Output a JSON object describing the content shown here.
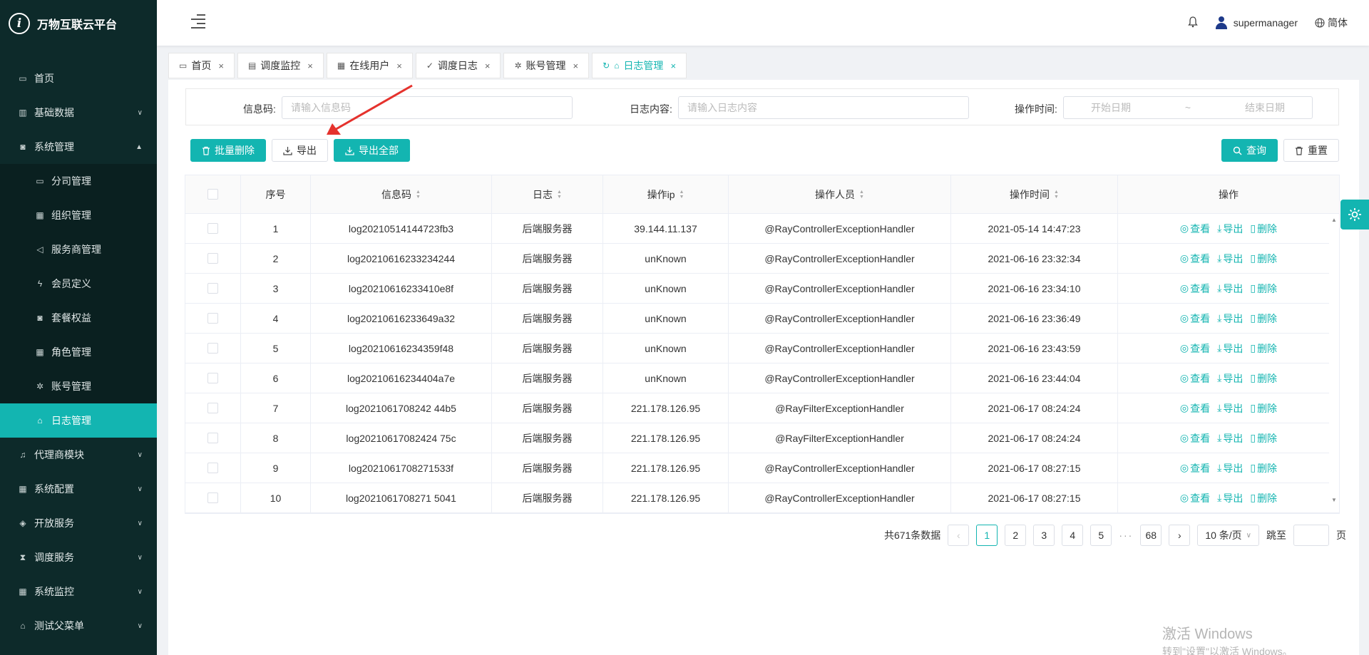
{
  "app": {
    "title": "万物互联云平台",
    "logo_letter": "i"
  },
  "header": {
    "username": "supermanager",
    "language": "简体"
  },
  "sidebar": {
    "items": [
      {
        "label": "首页",
        "icon": "calendar-icon"
      },
      {
        "label": "基础数据",
        "icon": "barcode-icon",
        "expandable": true
      },
      {
        "label": "系统管理",
        "icon": "camera-icon",
        "expandable": true,
        "expanded": true
      },
      {
        "label": "分司管理",
        "icon": "calendar-icon",
        "sub": true
      },
      {
        "label": "组织管理",
        "icon": "grid-icon",
        "sub": true
      },
      {
        "label": "服务商管理",
        "icon": "speaker-icon",
        "sub": true
      },
      {
        "label": "会员定义",
        "icon": "lightning-icon",
        "sub": true
      },
      {
        "label": "套餐权益",
        "icon": "camera-icon",
        "sub": true
      },
      {
        "label": "角色管理",
        "icon": "grid-icon",
        "sub": true
      },
      {
        "label": "账号管理",
        "icon": "bug-icon",
        "sub": true
      },
      {
        "label": "日志管理",
        "icon": "home-icon",
        "sub": true,
        "active": true
      },
      {
        "label": "代理商模块",
        "icon": "bell-icon",
        "expandable": true
      },
      {
        "label": "系统配置",
        "icon": "grid-icon",
        "expandable": true
      },
      {
        "label": "开放服务",
        "icon": "tag-icon",
        "expandable": true
      },
      {
        "label": "调度服务",
        "icon": "hourglass-icon",
        "expandable": true
      },
      {
        "label": "系统监控",
        "icon": "grid-icon",
        "expandable": true
      },
      {
        "label": "测试父菜单",
        "icon": "bank-icon",
        "expandable": true
      }
    ]
  },
  "tabs": [
    {
      "label": "首页",
      "icon": "calendar-icon"
    },
    {
      "label": "调度监控",
      "icon": "chart-icon"
    },
    {
      "label": "在线用户",
      "icon": "grid-icon"
    },
    {
      "label": "调度日志",
      "icon": "check-icon"
    },
    {
      "label": "账号管理",
      "icon": "bug-icon"
    },
    {
      "label": "日志管理",
      "icon": "home-icon",
      "active": true
    }
  ],
  "search": {
    "code_label": "信息码:",
    "code_placeholder": "请输入信息码",
    "content_label": "日志内容:",
    "content_placeholder": "请输入日志内容",
    "time_label": "操作时间:",
    "start_placeholder": "开始日期",
    "range_sep": "~",
    "end_placeholder": "结束日期"
  },
  "toolbar": {
    "batch_delete": "批量删除",
    "export": "导出",
    "export_all": "导出全部",
    "query": "查询",
    "reset": "重置"
  },
  "table": {
    "headers": [
      "序号",
      "信息码",
      "日志",
      "操作ip",
      "操作人员",
      "操作时间",
      "操作"
    ],
    "op_labels": {
      "view": "查看",
      "export": "导出",
      "delete": "删除"
    },
    "rows": [
      {
        "no": "1",
        "code": "log20210514144723fb3",
        "log": "后端服务器",
        "ip": "39.144.11.137",
        "operator": "@RayControllerExceptionHandler",
        "time": "2021-05-14 14:47:23"
      },
      {
        "no": "2",
        "code": "log20210616233234244",
        "log": "后端服务器",
        "ip": "unKnown",
        "operator": "@RayControllerExceptionHandler",
        "time": "2021-06-16 23:32:34"
      },
      {
        "no": "3",
        "code": "log20210616233410e8f",
        "log": "后端服务器",
        "ip": "unKnown",
        "operator": "@RayControllerExceptionHandler",
        "time": "2021-06-16 23:34:10"
      },
      {
        "no": "4",
        "code": "log20210616233649a32",
        "log": "后端服务器",
        "ip": "unKnown",
        "operator": "@RayControllerExceptionHandler",
        "time": "2021-06-16 23:36:49"
      },
      {
        "no": "5",
        "code": "log20210616234359f48",
        "log": "后端服务器",
        "ip": "unKnown",
        "operator": "@RayControllerExceptionHandler",
        "time": "2021-06-16 23:43:59"
      },
      {
        "no": "6",
        "code": "log20210616234404a7e",
        "log": "后端服务器",
        "ip": "unKnown",
        "operator": "@RayControllerExceptionHandler",
        "time": "2021-06-16 23:44:04"
      },
      {
        "no": "7",
        "code": "log2021061708242 44b5",
        "log": "后端服务器",
        "ip": "221.178.126.95",
        "operator": "@RayFilterExceptionHandler",
        "time": "2021-06-17 08:24:24"
      },
      {
        "no": "8",
        "code": "log20210617082424 75c",
        "log": "后端服务器",
        "ip": "221.178.126.95",
        "operator": "@RayFilterExceptionHandler",
        "time": "2021-06-17 08:24:24"
      },
      {
        "no": "9",
        "code": "log2021061708271533f",
        "log": "后端服务器",
        "ip": "221.178.126.95",
        "operator": "@RayControllerExceptionHandler",
        "time": "2021-06-17 08:27:15"
      },
      {
        "no": "10",
        "code": "log2021061708271 5041",
        "log": "后端服务器",
        "ip": "221.178.126.95",
        "operator": "@RayControllerExceptionHandler",
        "time": "2021-06-17 08:27:15"
      }
    ]
  },
  "pagination": {
    "total": "共671条数据",
    "pages": [
      "1",
      "2",
      "3",
      "4",
      "5"
    ],
    "ellipsis": "···",
    "last": "68",
    "page_size": "10 条/页",
    "jump_label": "跳至",
    "page_unit": "页"
  },
  "watermark": {
    "line1": "激活 Windows",
    "line2": "转到\"设置\"以激活 Windows。"
  },
  "colors": {
    "accent": "#13b5b1",
    "sidebar_bg": "#0d2a2a"
  }
}
